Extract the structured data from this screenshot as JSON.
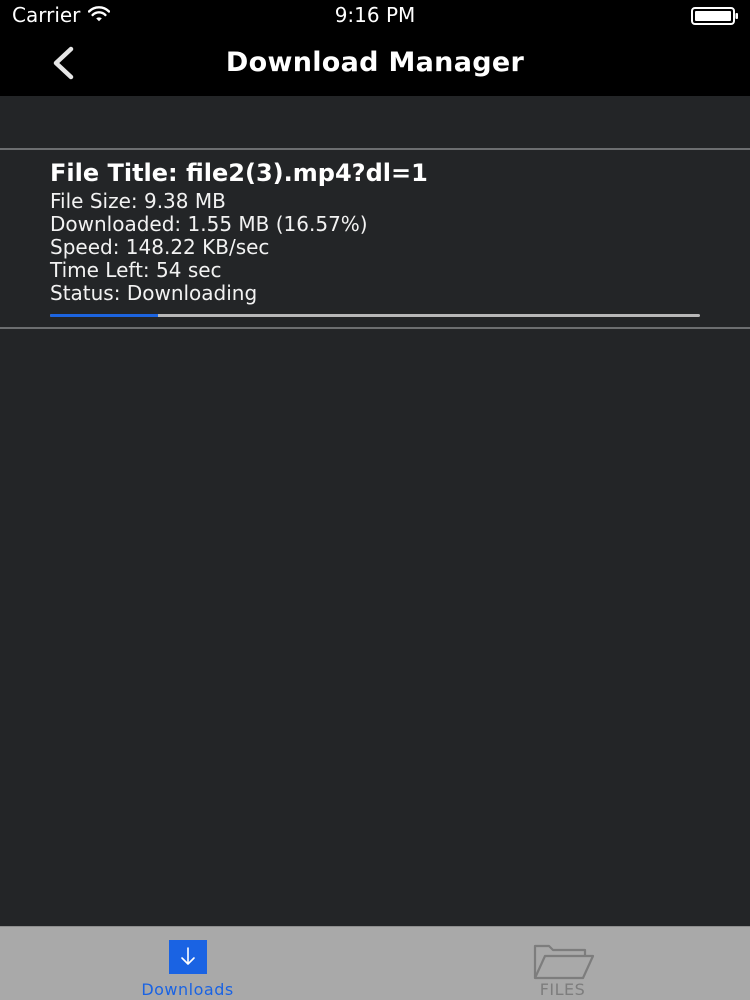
{
  "status_bar": {
    "carrier": "Carrier",
    "time": "9:16 PM",
    "wifi_icon": "wifi-icon",
    "battery_icon": "battery-full-icon"
  },
  "nav": {
    "title": "Download Manager",
    "back_icon": "chevron-left-icon"
  },
  "download": {
    "title": "File Title: file2(3).mp4?dl=1",
    "size": "File Size: 9.38 MB",
    "downloaded": "Downloaded: 1.55 MB (16.57%)",
    "speed": "Speed: 148.22 KB/sec",
    "time_left": "Time Left: 54 sec",
    "status": "Status: Downloading",
    "progress_fraction": 0.1657
  },
  "tabs": [
    {
      "label": "Downloads",
      "icon": "download-arrow-icon",
      "selected": true
    },
    {
      "label": "FILES",
      "icon": "folder-icon",
      "selected": false
    }
  ],
  "colors": {
    "accent": "#1a63e3",
    "background": "#232527",
    "bar_background": "#000000",
    "tab_bar_background": "#a9a9a9",
    "inactive_tab": "#7d7d7d"
  }
}
